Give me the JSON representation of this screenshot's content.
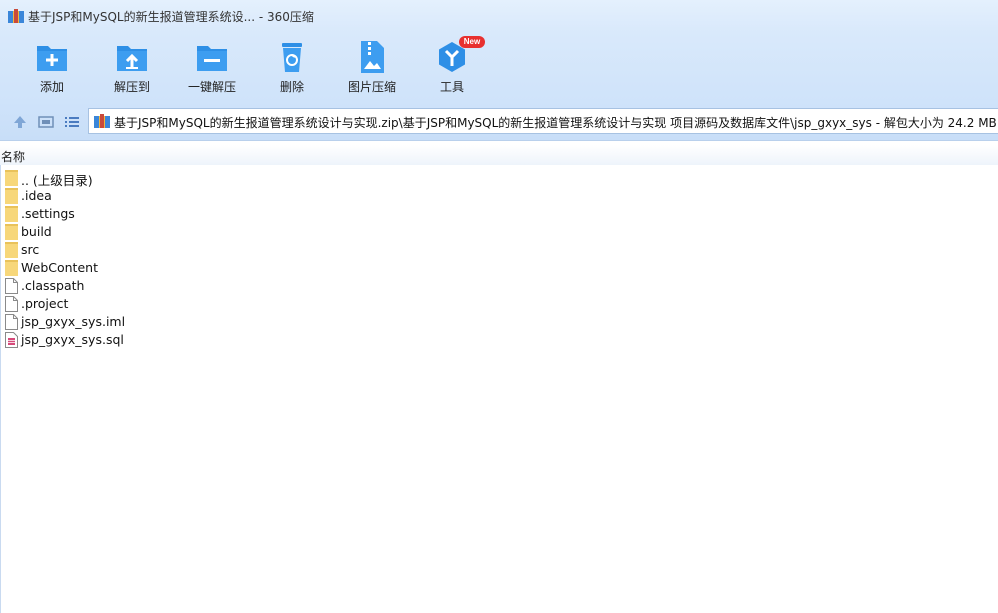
{
  "window": {
    "title": "基于JSP和MySQL的新生报道管理系统设... - 360压缩"
  },
  "toolbar": {
    "items": [
      {
        "id": "add",
        "label": "添加",
        "icon": "add-folder-icon"
      },
      {
        "id": "extract_to",
        "label": "解压到",
        "icon": "extract-to-icon"
      },
      {
        "id": "one_click",
        "label": "一键解压",
        "icon": "one-click-extract-icon"
      },
      {
        "id": "delete",
        "label": "删除",
        "icon": "trash-icon"
      },
      {
        "id": "image_compress",
        "label": "图片压缩",
        "icon": "image-compress-icon"
      },
      {
        "id": "tools",
        "label": "工具",
        "icon": "tools-icon",
        "badge": "New"
      }
    ]
  },
  "address": {
    "path": "基于JSP和MySQL的新生报道管理系统设计与实现.zip\\基于JSP和MySQL的新生报道管理系统设计与实现 项目源码及数据库文件\\jsp_gxyx_sys - 解包大小为 24.2 MB"
  },
  "list": {
    "column_name": "名称",
    "files": [
      {
        "name": ".. (上级目录)",
        "type": "folder"
      },
      {
        "name": ".idea",
        "type": "folder"
      },
      {
        "name": ".settings",
        "type": "folder"
      },
      {
        "name": "build",
        "type": "folder"
      },
      {
        "name": "src",
        "type": "folder"
      },
      {
        "name": "WebContent",
        "type": "folder"
      },
      {
        "name": ".classpath",
        "type": "file"
      },
      {
        "name": ".project",
        "type": "file"
      },
      {
        "name": "jsp_gxyx_sys.iml",
        "type": "file"
      },
      {
        "name": "jsp_gxyx_sys.sql",
        "type": "sql"
      }
    ]
  },
  "colors": {
    "accent": "#2e8fe6",
    "folder": "#f7d77a",
    "badge": "#e8302f"
  }
}
